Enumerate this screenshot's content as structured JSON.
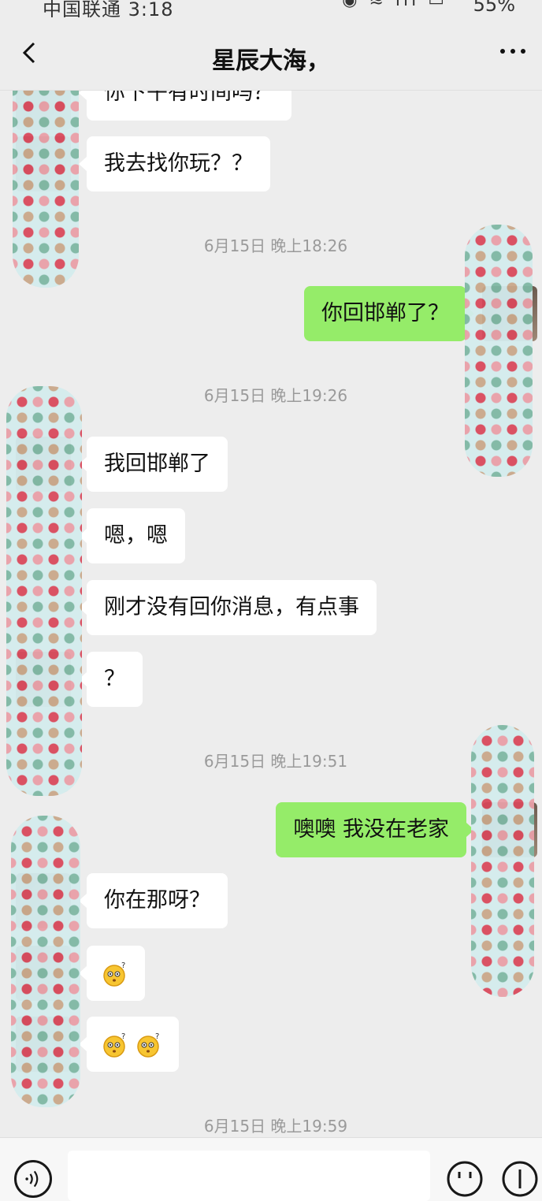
{
  "status_bar": {
    "carrier_time": "中国联通 3:18",
    "battery": "55%"
  },
  "nav": {
    "title": "星辰大海，"
  },
  "messages": {
    "m0": "你下午有时间吗？",
    "m1": "我去找你玩？？",
    "m2": "你回邯郸了？",
    "m3": "我回邯郸了",
    "m4": "嗯，嗯",
    "m5": "刚才没有回你消息，有点事",
    "m6": "？",
    "m7": "噢噢 我没在老家",
    "m8": "你在那呀？"
  },
  "timestamps": {
    "t1": "6月15日 晚上18:26",
    "t2": "6月15日 晚上19:26",
    "t3": "6月15日 晚上19:51",
    "t4": "6月15日 晚上19:59"
  },
  "colors": {
    "background": "#ededed",
    "incoming_bubble": "#ffffff",
    "outgoing_bubble": "#95ec69"
  },
  "icons": {
    "back": "chevron-left-icon",
    "more": "more-dots-icon",
    "voice": "voice-icon",
    "emoji": "emoji-icon",
    "plus": "plus-icon"
  }
}
